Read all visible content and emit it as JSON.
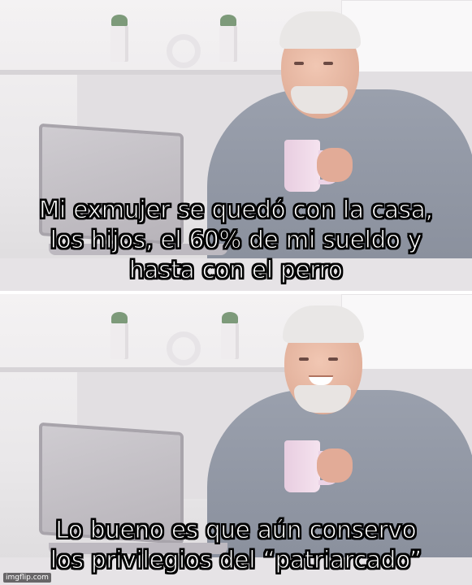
{
  "meme": {
    "top_caption": {
      "lines": [
        "Mi exmujer se quedó con la casa,",
        "los hijos, el 60% de mi sueldo y",
        "hasta con el perro"
      ]
    },
    "bottom_caption": {
      "lines": [
        "Lo bueno es que aún conservo",
        "los privilegios del “patriarcado”"
      ]
    },
    "watermark": "imgflip.com"
  },
  "colors": {
    "caption_fill": "#ffffff",
    "caption_outline": "#000000",
    "shirt": "#8f95a2",
    "mug": "#eed6e8"
  }
}
